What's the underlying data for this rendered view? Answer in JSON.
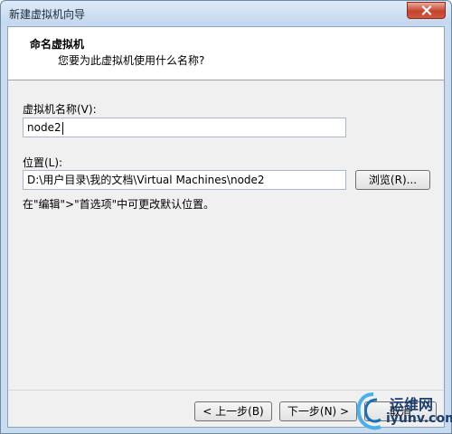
{
  "window": {
    "title": "新建虚拟机向导",
    "close_icon": "close-icon"
  },
  "header": {
    "title": "命名虚拟机",
    "subtitle": "您要为此虚拟机使用什么名称?"
  },
  "form": {
    "name_label": "虚拟机名称(V):",
    "name_value": "node2",
    "location_label": "位置(L):",
    "location_value": "D:\\用户目录\\我的文档\\Virtual Machines\\node2",
    "browse_label": "浏览(R)...",
    "hint": "在\"编辑\">\"首选项\"中可更改默认位置。"
  },
  "footer": {
    "back_label": "< 上一步(B)",
    "next_label": "下一步(N) >",
    "cancel_label": "取消"
  },
  "watermark": {
    "top": "运维网",
    "bottom": "iyunv.com"
  },
  "colors": {
    "close_button": "#c5432e",
    "title_bar": "#c9dcef",
    "watermark": "#1c3e6e"
  }
}
